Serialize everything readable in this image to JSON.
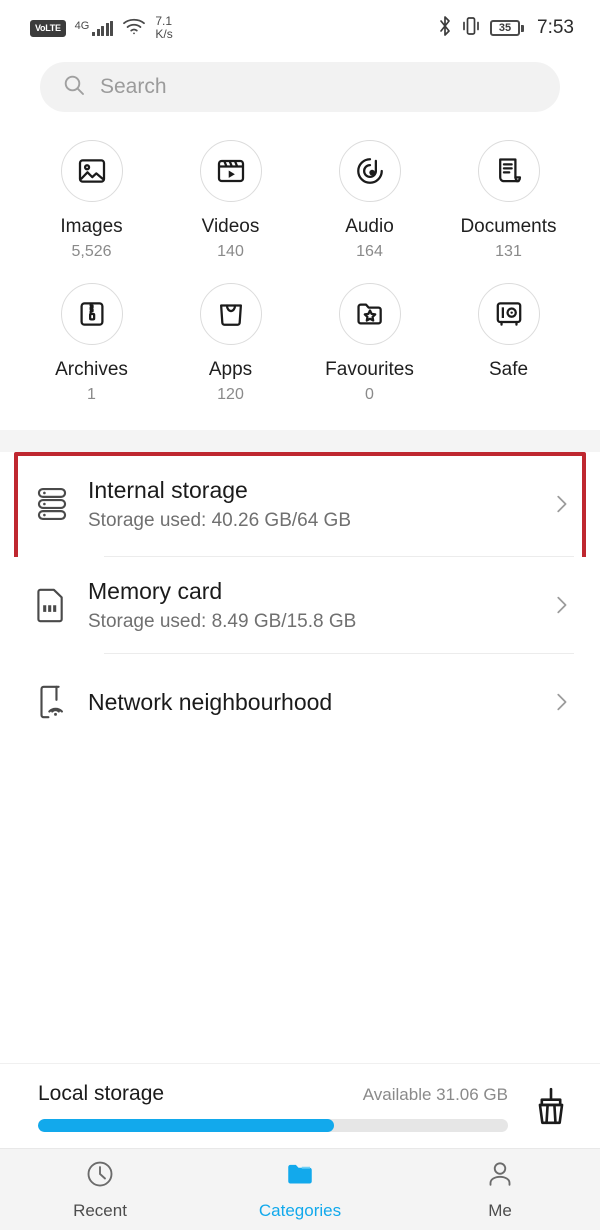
{
  "statusbar": {
    "volte": "VoLTE",
    "network_gen": "4G",
    "speed_value": "7.1",
    "speed_unit": "K/s",
    "battery_level": "35",
    "time": "7:53"
  },
  "search": {
    "placeholder": "Search"
  },
  "categories": [
    {
      "label": "Images",
      "count": "5,526",
      "icon": "image-icon"
    },
    {
      "label": "Videos",
      "count": "140",
      "icon": "video-icon"
    },
    {
      "label": "Audio",
      "count": "164",
      "icon": "audio-icon"
    },
    {
      "label": "Documents",
      "count": "131",
      "icon": "document-icon"
    },
    {
      "label": "Archives",
      "count": "1",
      "icon": "archive-icon"
    },
    {
      "label": "Apps",
      "count": "120",
      "icon": "apps-icon"
    },
    {
      "label": "Favourites",
      "count": "0",
      "icon": "favourites-icon"
    },
    {
      "label": "Safe",
      "count": "",
      "icon": "safe-icon"
    }
  ],
  "storage_rows": [
    {
      "title": "Internal storage",
      "subtitle": "Storage used: 40.26 GB/64 GB",
      "icon": "internal-storage-icon",
      "highlighted": true
    },
    {
      "title": "Memory card",
      "subtitle": "Storage used: 8.49 GB/15.8 GB",
      "icon": "memory-card-icon",
      "highlighted": false
    },
    {
      "title": "Network neighbourhood",
      "subtitle": "",
      "icon": "network-neighbourhood-icon",
      "highlighted": false
    }
  ],
  "local_storage": {
    "title": "Local storage",
    "available": "Available 31.06 GB",
    "used_percent": 63,
    "bar_color": "#12a9ec",
    "cleanup_icon": "broom-icon"
  },
  "bottom_nav": [
    {
      "label": "Recent",
      "icon": "clock-icon",
      "active": false
    },
    {
      "label": "Categories",
      "icon": "folder-icon",
      "active": true
    },
    {
      "label": "Me",
      "icon": "person-icon",
      "active": false
    }
  ],
  "colors": {
    "accent": "#12a9ec",
    "highlight_border": "#bf2730"
  }
}
